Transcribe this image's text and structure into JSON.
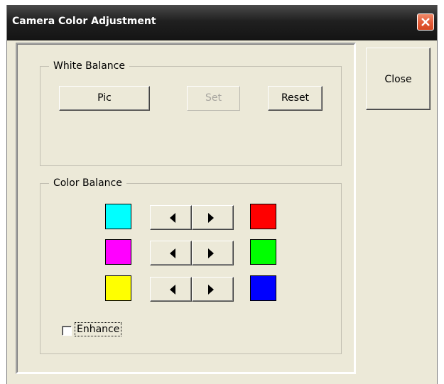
{
  "window": {
    "title": "Camera Color Adjustment"
  },
  "close_button_label": "Close",
  "white_balance": {
    "legend": "White Balance",
    "pic_label": "Pic",
    "set_label": "Set",
    "reset_label": "Reset"
  },
  "color_balance": {
    "legend": "Color Balance",
    "rows": [
      {
        "left_color": "#00ffff",
        "right_color": "#ff0000",
        "left_name": "cyan",
        "right_name": "red"
      },
      {
        "left_color": "#ff00ff",
        "right_color": "#00ff00",
        "left_name": "magenta",
        "right_name": "green"
      },
      {
        "left_color": "#ffff00",
        "right_color": "#0000ff",
        "left_name": "yellow",
        "right_name": "blue"
      }
    ],
    "enhance_label": "Enhance",
    "enhance_checked": false
  }
}
